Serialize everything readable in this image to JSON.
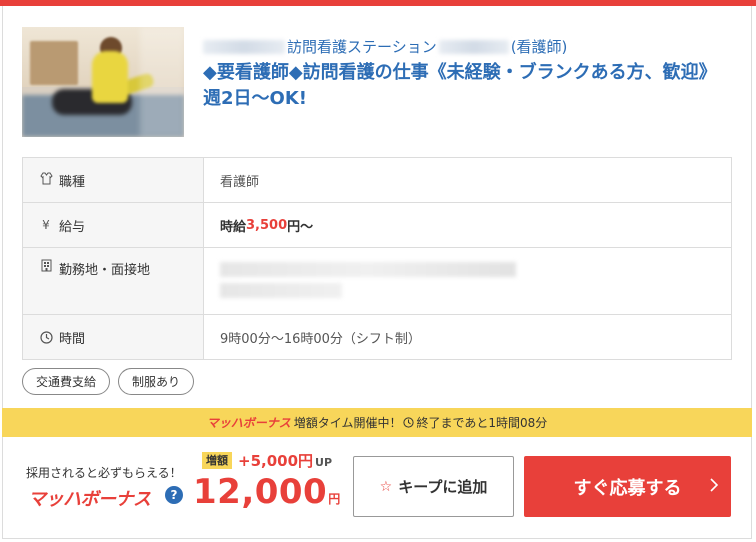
{
  "header": {
    "facility_name": "訪問看護ステーション",
    "job_type_suffix": "(看護師)",
    "title": "◆要看護師◆訪問看護の仕事《未経験・ブランクある方、歓迎》週2日～OK!"
  },
  "details": {
    "job_label": "職種",
    "job_value": "看護師",
    "salary_label": "給与",
    "salary_prefix": "時給",
    "salary_amount": "3,500",
    "salary_suffix": "円～",
    "location_label": "勤務地・面接地",
    "hours_label": "時間",
    "hours_value": "9時00分～16時00分（シフト制）"
  },
  "tags": [
    "交通費支給",
    "制服あり"
  ],
  "banner": {
    "logo": "マッハボーナス",
    "text": "増額タイム開催中！",
    "countdown": "終了まであと1時間08分"
  },
  "bonus": {
    "intro": "採用されると必ずもらえる！",
    "logo": "マッハボーナス",
    "help": "?",
    "badge": "増額",
    "plus_amount": "+5,000円",
    "up_label": "UP",
    "amount": "12,000",
    "unit": "円"
  },
  "actions": {
    "keep_label": "キープに追加",
    "apply_label": "すぐ応募する"
  },
  "colors": {
    "accent_red": "#e8403a",
    "link_blue": "#2d6db5",
    "banner_yellow": "#f8d65a"
  }
}
